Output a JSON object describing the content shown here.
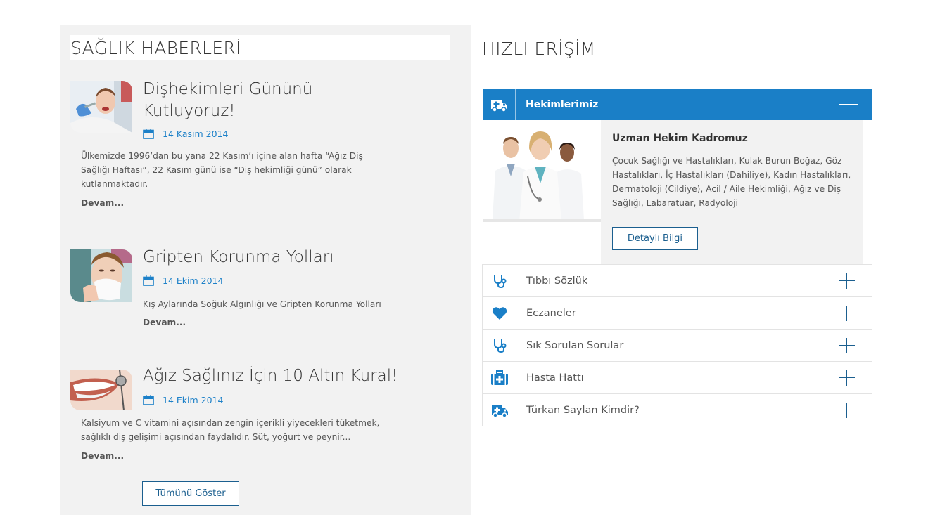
{
  "left": {
    "title": "SAĞLIK HABERLERİ",
    "news": [
      {
        "title_line1": "Dişhekimleri Gününü",
        "title_line2": "Kutluyoruz!",
        "date": "14 Kasım 2014",
        "text_line1": "Ülkemizde 1996’dan bu yana 22 Kasım’ı içine alan hafta “Ağız Diş",
        "text_line2": "Sağlığı Haftası”, 22 Kasım günü ise “Diş hekimliği günü” olarak",
        "text_line3": "kutlanmaktadır.",
        "more": "Devam..."
      },
      {
        "title_line1": "Gripten Korunma Yolları",
        "date": "14 Ekim 2014",
        "text_line1": "Kış Aylarında Soğuk Algınlığı ve Gripten Korunma Yolları",
        "more": "Devam..."
      },
      {
        "title_line1": "Ağız Sağlınız İçin 10 Altın Kural!",
        "date": "14 Ekim 2014",
        "text_line1": "Kalsiyum ve C vitamini açısından zengin içerikli yiyecekleri tüketmek,",
        "text_line2": "sağlıklı diş gelişimi açısından faydalıdır. Süt, yoğurt ve peynir...",
        "more": "Devam..."
      }
    ],
    "show_all": "Tümünü Göster"
  },
  "right": {
    "title": "HIZLI ERİŞİM",
    "open_item": {
      "label": "Hekimlerimiz",
      "icon": "ambulance-icon",
      "heading": "Uzman Hekim Kadromuz",
      "text": "Çocuk Sağlığı ve Hastalıkları, Kulak Burun Boğaz, Göz Hastalıkları, İç Hastalıkları (Dahiliye), Kadın Hastalıkları, Dermatoloji (Cildiye), Acil / Aile Hekimliği, Ağız ve Diş Sağlığı, Labaratuar, Radyoloji",
      "button": "Detaylı Bilgi"
    },
    "items": [
      {
        "label": "Tıbbı Sözlük",
        "icon": "stethoscope-icon"
      },
      {
        "label": "Eczaneler",
        "icon": "heart-icon"
      },
      {
        "label": "Sık Sorulan Sorular",
        "icon": "stethoscope-icon"
      },
      {
        "label": "Hasta Hattı",
        "icon": "medkit-icon"
      },
      {
        "label": "Türkan Saylan Kimdir?",
        "icon": "ambulance-icon"
      }
    ]
  },
  "colors": {
    "accent": "#1a7fc7",
    "button_border": "#1b5f8f",
    "panel_bg": "#f2f2f2"
  }
}
